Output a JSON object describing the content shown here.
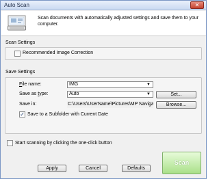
{
  "window": {
    "title": "Auto Scan",
    "close_glyph": "✕"
  },
  "header": {
    "icon": "scanner-document-icon",
    "description": "Scan documents with automatically adjusted settings and save them to your computer."
  },
  "scan_settings": {
    "heading": "Scan Settings",
    "recommended_correction": {
      "label": "Recommended Image Correction",
      "checked": false
    }
  },
  "save_settings": {
    "heading": "Save Settings",
    "file_name": {
      "label_pre": "",
      "label_u": "F",
      "label_post": "ile name:",
      "value": "IMG"
    },
    "save_as_type": {
      "label_pre": "Save as ",
      "label_u": "t",
      "label_post": "ype:",
      "value": "Auto",
      "set_button": "Set..."
    },
    "save_in": {
      "label": "Save in:",
      "value": "C:\\Users\\UserName\\Pictures\\MP Navigator",
      "browse_button": "Browse..."
    },
    "subfolder": {
      "label": "Save to a Subfolder with Current Date",
      "checked": true
    }
  },
  "one_click": {
    "label": "Start scanning by clicking the one-click button",
    "checked": false
  },
  "buttons": {
    "apply": "Apply",
    "cancel": "Cancel",
    "defaults": "Defaults",
    "scan": "Scan"
  },
  "colors": {
    "scan_button": "#a9e089",
    "close_button": "#c54330"
  }
}
